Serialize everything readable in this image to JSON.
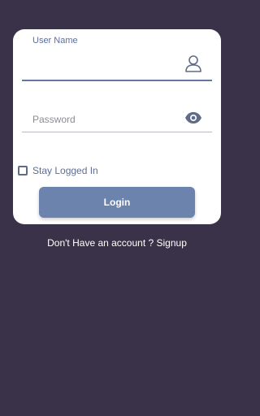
{
  "form": {
    "username_label": "User Name",
    "username_value": "",
    "password_placeholder": "Password",
    "password_value": "",
    "stay_logged_in_label": "Stay Logged In",
    "stay_logged_in_checked": false,
    "login_label": "Login"
  },
  "footer": {
    "signup_text": "Don't Have an account ? Signup"
  },
  "icons": {
    "username": "user-icon",
    "password": "eye-icon"
  },
  "colors": {
    "background": "#3a3249",
    "accent": "#6c83ad",
    "label": "#5b6f9d"
  }
}
